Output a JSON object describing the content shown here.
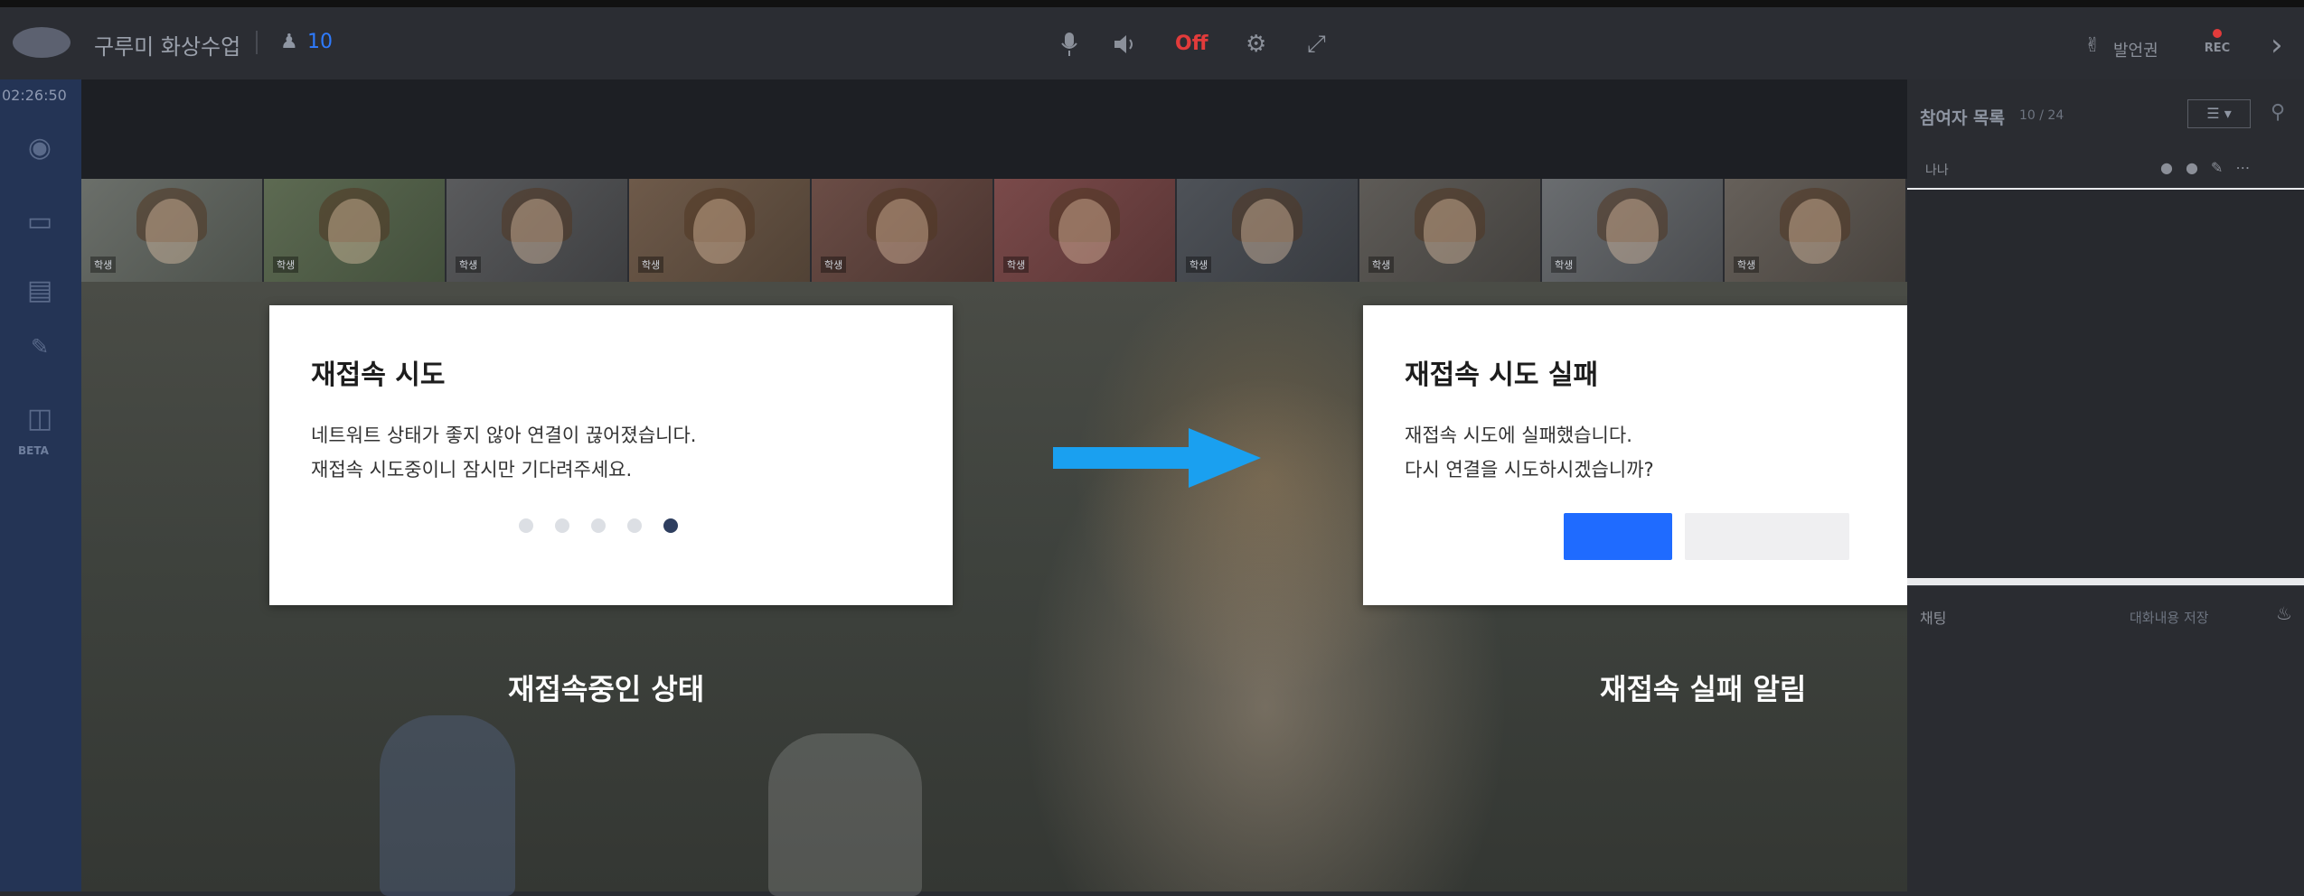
{
  "topbar": {
    "title": "구루미 화상수업",
    "user_count": "10",
    "icons": [
      "microphone-icon",
      "speaker-icon",
      "camera-off-icon",
      "settings-icon",
      "fullscreen-icon"
    ],
    "camera_status": "Off",
    "speak_label": "발언권",
    "rec_label": "REC"
  },
  "sidebar": {
    "timer": "02:26:50",
    "beta_label": "BETA",
    "icons": [
      "user-circle-icon",
      "screen-share-icon",
      "document-icon",
      "whiteboard-icon",
      "book-icon"
    ]
  },
  "thumbnails": [
    {
      "tag": "학생"
    },
    {
      "tag": "학생"
    },
    {
      "tag": "학생"
    },
    {
      "tag": "학생"
    },
    {
      "tag": "학생"
    },
    {
      "tag": "학생"
    },
    {
      "tag": "학생"
    },
    {
      "tag": "학생"
    },
    {
      "tag": "학생"
    },
    {
      "tag": "학생"
    }
  ],
  "dialog_reconnect": {
    "title": "재접속 시도",
    "line1": "네트워트 상태가 좋지 않아 연결이 끊어졌습니다.",
    "line2": "재접속 시도중이니 잠시만 기다려주세요.",
    "dots_total": 5,
    "dots_active_index": 4
  },
  "dialog_fail": {
    "title": "재접속 시도 실패",
    "line1": "재접속 시도에 실패했습니다.",
    "line2": "다시 연결을 시도하시겠습니까?",
    "ok_color": "#1f6bff",
    "cancel_color": "#efeff1"
  },
  "stage_labels": {
    "left": "재접속중인 상태",
    "right": "재접속 실패 알림"
  },
  "arrow_color": "#1aa0f0",
  "right_panel": {
    "participants_title": "참여자 목록",
    "participants_count": "10 / 24",
    "participant_row": "나나",
    "chat_title": "채팅",
    "chat_save_label": "대화내용 저장"
  }
}
